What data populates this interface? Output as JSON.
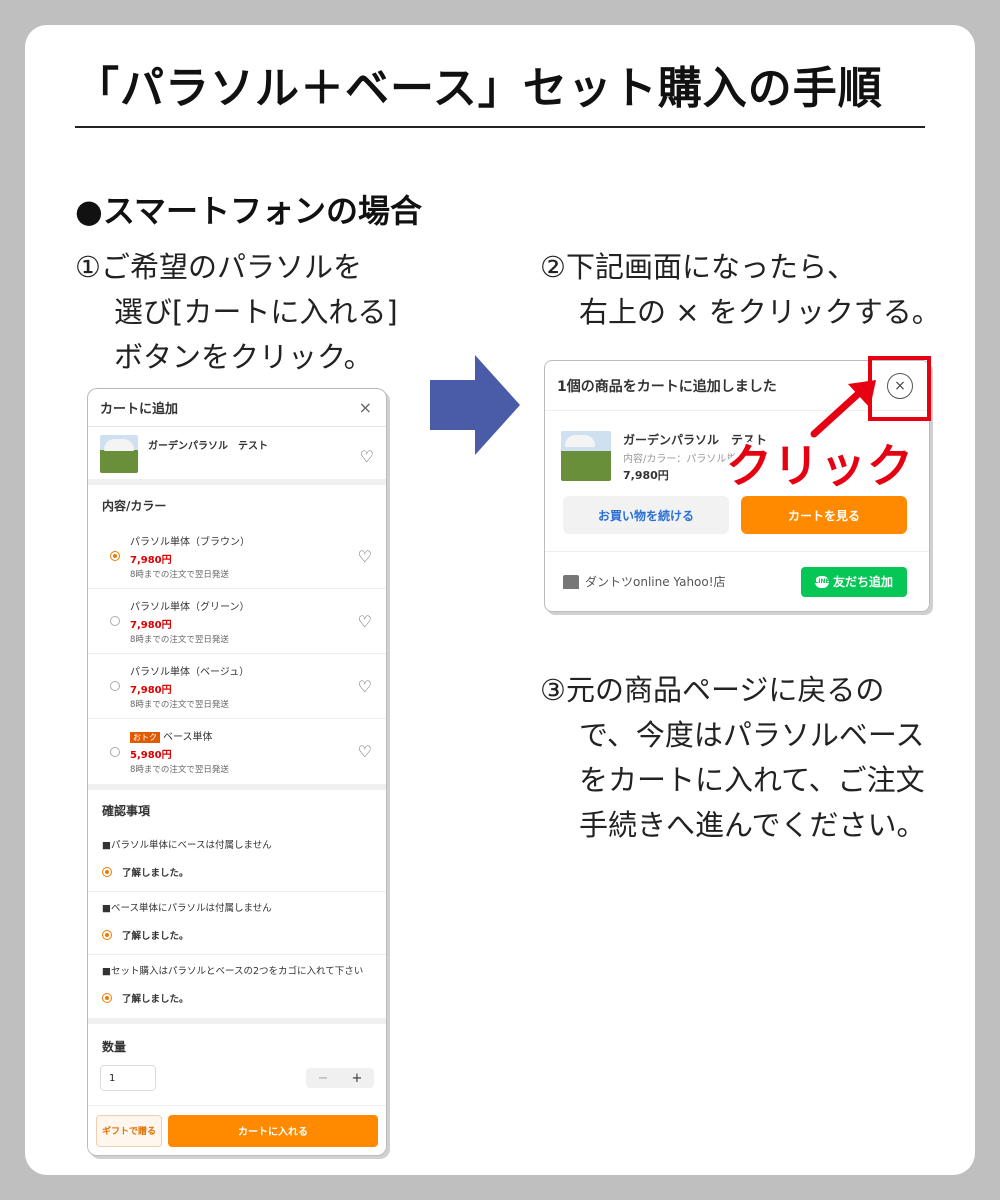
{
  "title": "「パラソル＋ベース」セット購入の手順",
  "section_heading": "●スマートフォンの場合",
  "step1": {
    "line1": "①ご希望のパラソルを",
    "line2": "選び[カートに入れる]",
    "line3": "ボタンをクリック。"
  },
  "step2": {
    "line1": "②下記画面になったら、",
    "line2": "右上の × をクリックする。"
  },
  "step3": {
    "line1": "③元の商品ページに戻るの",
    "line2": "で、今度はパラソルベース",
    "line3": "をカートに入れて、ご注文",
    "line4": "手続きへ進んでください。"
  },
  "phone": {
    "header_title": "カートに追加",
    "close_icon": "×",
    "product_name": "ガーデンパラソル　テスト",
    "heart_icon": "♡",
    "variant_section_title": "内容/カラー",
    "options": [
      {
        "name": "パラソル単体（ブラウン）",
        "price": "7,980円",
        "shipping": "8時までの注文で翌日発送",
        "selected": true,
        "badge": ""
      },
      {
        "name": "パラソル単体（グリーン）",
        "price": "7,980円",
        "shipping": "8時までの注文で翌日発送",
        "selected": false,
        "badge": ""
      },
      {
        "name": "パラソル単体（ベージュ）",
        "price": "7,980円",
        "shipping": "8時までの注文で翌日発送",
        "selected": false,
        "badge": ""
      },
      {
        "name": "ベース単体",
        "price": "5,980円",
        "shipping": "8時までの注文で翌日発送",
        "selected": false,
        "badge": "おトク"
      }
    ],
    "confirm_section_title": "確認事項",
    "confirm_items": [
      {
        "text": "■パラソル単体にベースは付属しません",
        "ok": "了解しました。"
      },
      {
        "text": "■ベース単体にパラソルは付属しません",
        "ok": "了解しました。"
      },
      {
        "text": "■セット購入はパラソルとベースの2つをカゴに入れて下さい",
        "ok": "了解しました。"
      }
    ],
    "quantity_title": "数量",
    "quantity_value": "1",
    "minus": "−",
    "plus": "+",
    "gift_button": "ギフトで贈る",
    "cart_button": "カートに入れる"
  },
  "dialog": {
    "title": "1個の商品をカートに追加しました",
    "close_icon": "×",
    "product_name": "ガーデンパラソル　テスト",
    "variant": "内容/カラー：パラソル単…",
    "price": "7,980円",
    "continue_button": "お買い物を続ける",
    "view_cart_button": "カートを見る",
    "store_name": "ダントツonline Yahoo!店",
    "line_icon_text": "LINE",
    "line_button": "友だち追加"
  },
  "annotation": {
    "click_label": "クリック"
  },
  "colors": {
    "accent_orange": "#ff8a00",
    "highlight_red": "#e60012",
    "line_green": "#06c755",
    "arrow_blue": "#4a5ba8"
  }
}
